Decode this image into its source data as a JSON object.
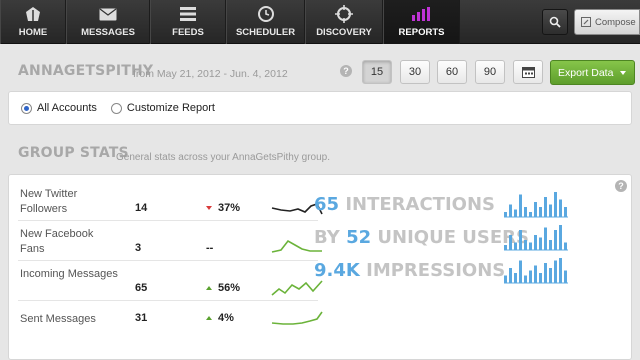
{
  "nav": {
    "items": [
      {
        "label": "HOME",
        "icon": "home-icon"
      },
      {
        "label": "MESSAGES",
        "icon": "envelope-icon"
      },
      {
        "label": "FEEDS",
        "icon": "feeds-icon"
      },
      {
        "label": "SCHEDULER",
        "icon": "clock-icon"
      },
      {
        "label": "DISCOVERY",
        "icon": "crosshair-icon"
      },
      {
        "label": "REPORTS",
        "icon": "bar-chart-icon",
        "active": true
      }
    ],
    "compose_label": "Compose"
  },
  "header": {
    "username": "ANNAGETSPITHY",
    "date_range": "from May 21, 2012 - Jun. 4, 2012",
    "help": "?",
    "periods": [
      "15",
      "30",
      "60",
      "90"
    ],
    "selected_period": "15",
    "export_label": "Export Data"
  },
  "accounts": {
    "options": [
      "All Accounts",
      "Customize Report"
    ],
    "selected": "All Accounts"
  },
  "group_stats": {
    "title": "GROUP STATS",
    "subtitle": "General stats across your AnnaGetsPithy group.",
    "help": "?",
    "rows": [
      {
        "label": "New Twitter Followers",
        "value": "14",
        "change": "37%",
        "trend": "down",
        "spark_color": "#222222"
      },
      {
        "label": "New Facebook Fans",
        "value": "3",
        "change": "--",
        "trend": "none",
        "spark_color": "#6bb33a"
      },
      {
        "label": "Incoming Messages",
        "value": "65",
        "change": "56%",
        "trend": "up",
        "spark_color": "#6bb33a"
      },
      {
        "label": "Sent Messages",
        "value": "31",
        "change": "4%",
        "trend": "up",
        "spark_color": "#6bb33a"
      }
    ],
    "summary": [
      {
        "number": "65",
        "text": "INTERACTIONS"
      },
      {
        "number": "52",
        "prefix": "BY",
        "text": "UNIQUE USERS"
      },
      {
        "number": "9.4K",
        "text": "IMPRESSIONS"
      }
    ],
    "colors": {
      "accent_blue": "#5aa8e0",
      "muted": "#c4c4c4",
      "green": "#6bb33a",
      "red": "#d93b3b"
    }
  }
}
